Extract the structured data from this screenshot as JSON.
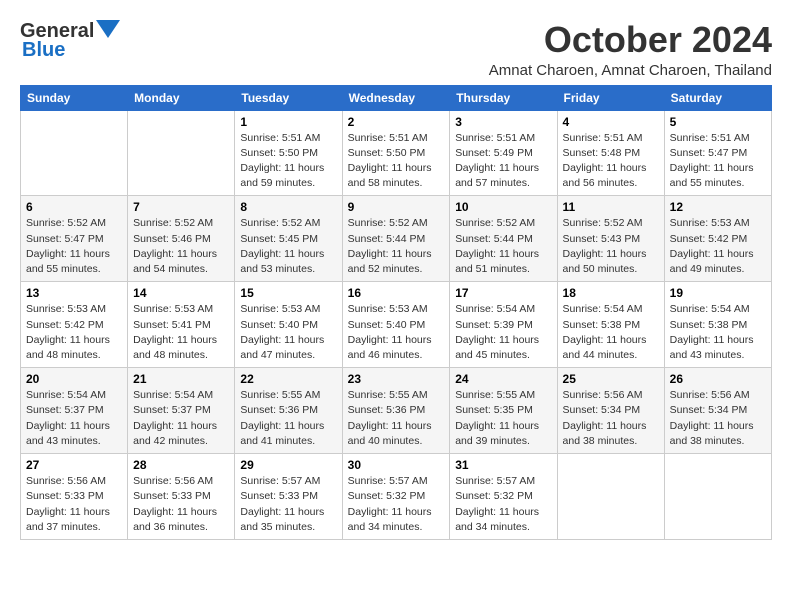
{
  "header": {
    "logo_general": "General",
    "logo_blue": "Blue",
    "month_title": "October 2024",
    "location": "Amnat Charoen, Amnat Charoen, Thailand"
  },
  "days_of_week": [
    "Sunday",
    "Monday",
    "Tuesday",
    "Wednesday",
    "Thursday",
    "Friday",
    "Saturday"
  ],
  "weeks": [
    [
      {
        "day": "",
        "sunrise": "",
        "sunset": "",
        "daylight": ""
      },
      {
        "day": "",
        "sunrise": "",
        "sunset": "",
        "daylight": ""
      },
      {
        "day": "1",
        "sunrise": "Sunrise: 5:51 AM",
        "sunset": "Sunset: 5:50 PM",
        "daylight": "Daylight: 11 hours and 59 minutes."
      },
      {
        "day": "2",
        "sunrise": "Sunrise: 5:51 AM",
        "sunset": "Sunset: 5:50 PM",
        "daylight": "Daylight: 11 hours and 58 minutes."
      },
      {
        "day": "3",
        "sunrise": "Sunrise: 5:51 AM",
        "sunset": "Sunset: 5:49 PM",
        "daylight": "Daylight: 11 hours and 57 minutes."
      },
      {
        "day": "4",
        "sunrise": "Sunrise: 5:51 AM",
        "sunset": "Sunset: 5:48 PM",
        "daylight": "Daylight: 11 hours and 56 minutes."
      },
      {
        "day": "5",
        "sunrise": "Sunrise: 5:51 AM",
        "sunset": "Sunset: 5:47 PM",
        "daylight": "Daylight: 11 hours and 55 minutes."
      }
    ],
    [
      {
        "day": "6",
        "sunrise": "Sunrise: 5:52 AM",
        "sunset": "Sunset: 5:47 PM",
        "daylight": "Daylight: 11 hours and 55 minutes."
      },
      {
        "day": "7",
        "sunrise": "Sunrise: 5:52 AM",
        "sunset": "Sunset: 5:46 PM",
        "daylight": "Daylight: 11 hours and 54 minutes."
      },
      {
        "day": "8",
        "sunrise": "Sunrise: 5:52 AM",
        "sunset": "Sunset: 5:45 PM",
        "daylight": "Daylight: 11 hours and 53 minutes."
      },
      {
        "day": "9",
        "sunrise": "Sunrise: 5:52 AM",
        "sunset": "Sunset: 5:44 PM",
        "daylight": "Daylight: 11 hours and 52 minutes."
      },
      {
        "day": "10",
        "sunrise": "Sunrise: 5:52 AM",
        "sunset": "Sunset: 5:44 PM",
        "daylight": "Daylight: 11 hours and 51 minutes."
      },
      {
        "day": "11",
        "sunrise": "Sunrise: 5:52 AM",
        "sunset": "Sunset: 5:43 PM",
        "daylight": "Daylight: 11 hours and 50 minutes."
      },
      {
        "day": "12",
        "sunrise": "Sunrise: 5:53 AM",
        "sunset": "Sunset: 5:42 PM",
        "daylight": "Daylight: 11 hours and 49 minutes."
      }
    ],
    [
      {
        "day": "13",
        "sunrise": "Sunrise: 5:53 AM",
        "sunset": "Sunset: 5:42 PM",
        "daylight": "Daylight: 11 hours and 48 minutes."
      },
      {
        "day": "14",
        "sunrise": "Sunrise: 5:53 AM",
        "sunset": "Sunset: 5:41 PM",
        "daylight": "Daylight: 11 hours and 48 minutes."
      },
      {
        "day": "15",
        "sunrise": "Sunrise: 5:53 AM",
        "sunset": "Sunset: 5:40 PM",
        "daylight": "Daylight: 11 hours and 47 minutes."
      },
      {
        "day": "16",
        "sunrise": "Sunrise: 5:53 AM",
        "sunset": "Sunset: 5:40 PM",
        "daylight": "Daylight: 11 hours and 46 minutes."
      },
      {
        "day": "17",
        "sunrise": "Sunrise: 5:54 AM",
        "sunset": "Sunset: 5:39 PM",
        "daylight": "Daylight: 11 hours and 45 minutes."
      },
      {
        "day": "18",
        "sunrise": "Sunrise: 5:54 AM",
        "sunset": "Sunset: 5:38 PM",
        "daylight": "Daylight: 11 hours and 44 minutes."
      },
      {
        "day": "19",
        "sunrise": "Sunrise: 5:54 AM",
        "sunset": "Sunset: 5:38 PM",
        "daylight": "Daylight: 11 hours and 43 minutes."
      }
    ],
    [
      {
        "day": "20",
        "sunrise": "Sunrise: 5:54 AM",
        "sunset": "Sunset: 5:37 PM",
        "daylight": "Daylight: 11 hours and 43 minutes."
      },
      {
        "day": "21",
        "sunrise": "Sunrise: 5:54 AM",
        "sunset": "Sunset: 5:37 PM",
        "daylight": "Daylight: 11 hours and 42 minutes."
      },
      {
        "day": "22",
        "sunrise": "Sunrise: 5:55 AM",
        "sunset": "Sunset: 5:36 PM",
        "daylight": "Daylight: 11 hours and 41 minutes."
      },
      {
        "day": "23",
        "sunrise": "Sunrise: 5:55 AM",
        "sunset": "Sunset: 5:36 PM",
        "daylight": "Daylight: 11 hours and 40 minutes."
      },
      {
        "day": "24",
        "sunrise": "Sunrise: 5:55 AM",
        "sunset": "Sunset: 5:35 PM",
        "daylight": "Daylight: 11 hours and 39 minutes."
      },
      {
        "day": "25",
        "sunrise": "Sunrise: 5:56 AM",
        "sunset": "Sunset: 5:34 PM",
        "daylight": "Daylight: 11 hours and 38 minutes."
      },
      {
        "day": "26",
        "sunrise": "Sunrise: 5:56 AM",
        "sunset": "Sunset: 5:34 PM",
        "daylight": "Daylight: 11 hours and 38 minutes."
      }
    ],
    [
      {
        "day": "27",
        "sunrise": "Sunrise: 5:56 AM",
        "sunset": "Sunset: 5:33 PM",
        "daylight": "Daylight: 11 hours and 37 minutes."
      },
      {
        "day": "28",
        "sunrise": "Sunrise: 5:56 AM",
        "sunset": "Sunset: 5:33 PM",
        "daylight": "Daylight: 11 hours and 36 minutes."
      },
      {
        "day": "29",
        "sunrise": "Sunrise: 5:57 AM",
        "sunset": "Sunset: 5:33 PM",
        "daylight": "Daylight: 11 hours and 35 minutes."
      },
      {
        "day": "30",
        "sunrise": "Sunrise: 5:57 AM",
        "sunset": "Sunset: 5:32 PM",
        "daylight": "Daylight: 11 hours and 34 minutes."
      },
      {
        "day": "31",
        "sunrise": "Sunrise: 5:57 AM",
        "sunset": "Sunset: 5:32 PM",
        "daylight": "Daylight: 11 hours and 34 minutes."
      },
      {
        "day": "",
        "sunrise": "",
        "sunset": "",
        "daylight": ""
      },
      {
        "day": "",
        "sunrise": "",
        "sunset": "",
        "daylight": ""
      }
    ]
  ]
}
